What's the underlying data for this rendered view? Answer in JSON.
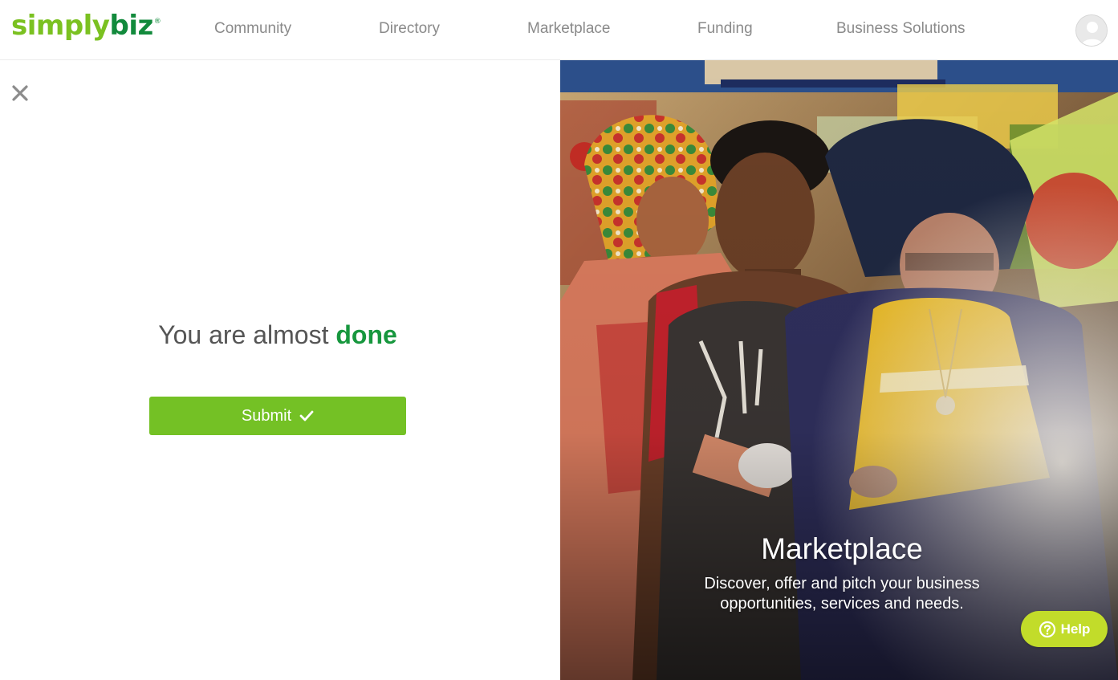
{
  "brand": {
    "logo_part_a": "simply",
    "logo_part_b": "biz",
    "logo_mark": "®",
    "colors": {
      "primary_green": "#74c125",
      "dark_green": "#17973e",
      "help_lime": "#c2dc2a"
    }
  },
  "nav": {
    "items": [
      {
        "label": "Community"
      },
      {
        "label": "Directory"
      },
      {
        "label": "Marketplace"
      },
      {
        "label": "Funding"
      },
      {
        "label": "Business Solutions"
      }
    ],
    "avatar_icon": "user-avatar-icon"
  },
  "main": {
    "close_icon": "close-icon",
    "heading_prefix": "You are almost",
    "heading_accent": "done",
    "submit_label": "Submit",
    "submit_icon": "checkmark-icon"
  },
  "hero": {
    "title": "Marketplace",
    "description_line1": "Discover, offer and pitch your business",
    "description_line2": "opportunities, services and needs."
  },
  "help": {
    "label": "Help",
    "icon": "question-circle-icon"
  }
}
